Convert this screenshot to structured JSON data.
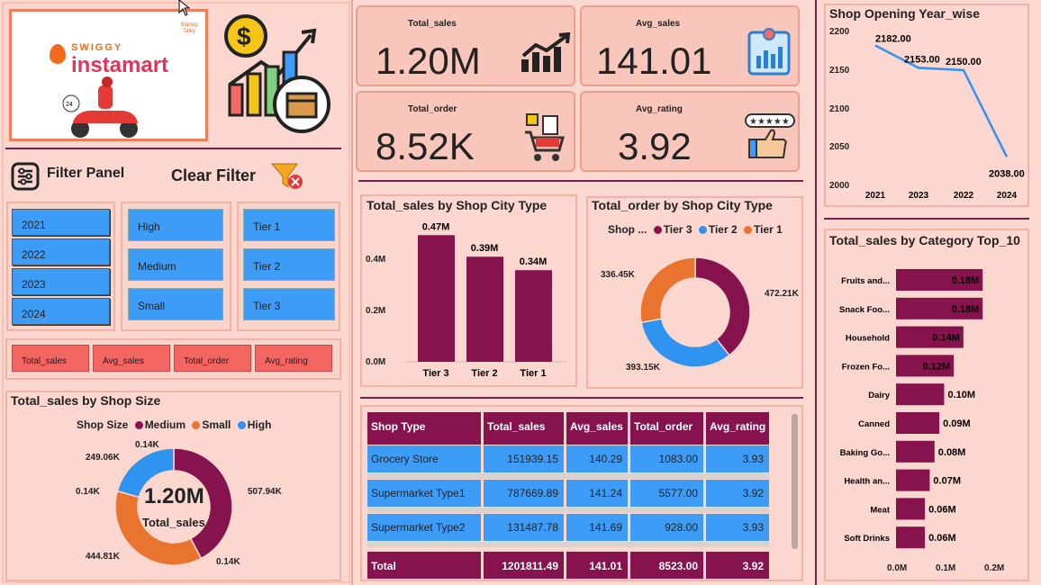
{
  "colors": {
    "maroon": "#86124e",
    "blue": "#2f93f0",
    "orange": "#e8742f",
    "slicer": "#3d9cf5",
    "button": "#f26561"
  },
  "logo": {
    "brand_top": "SWIGGY",
    "brand_bottom": "instamart",
    "badge": "Startup Talky"
  },
  "filter": {
    "title": "Filter Panel",
    "clear": "Clear Filter"
  },
  "slicers": {
    "years": [
      "2021",
      "2022",
      "2023",
      "2024"
    ],
    "sizes": [
      "High",
      "Medium",
      "Small"
    ],
    "tiers": [
      "Tier 1",
      "Tier 2",
      "Tier 3"
    ]
  },
  "metric_buttons": [
    "Total_sales",
    "Avg_sales",
    "Total_order",
    "Avg_rating"
  ],
  "kpis": [
    {
      "label": "Total_sales",
      "value": "1.20M",
      "icon": "growth-chart-icon"
    },
    {
      "label": "Avg_sales",
      "value": "141.01",
      "icon": "sales-report-icon"
    },
    {
      "label": "Total_order",
      "value": "8.52K",
      "icon": "shopping-cart-icon"
    },
    {
      "label": "Avg_rating",
      "value": "3.92",
      "icon": "thumbs-up-rating-icon"
    }
  ],
  "shop_size_chart": {
    "title": "Total_sales by Shop Size",
    "legend_title": "Shop Size",
    "center_value": "1.20M",
    "center_label": "Total_sales",
    "labels": [
      "507.94K",
      "444.81K",
      "249.06K",
      "0.14K",
      "0.14K",
      "0.14K"
    ]
  },
  "tier_sales_chart": {
    "title": "Total_sales by Shop City Type",
    "yticks": [
      "0.4M",
      "0.2M",
      "0.0M"
    ]
  },
  "tier_order_chart": {
    "title": "Total_order by Shop City Type",
    "legend_title": "Shop ...",
    "labels": [
      "472.21K",
      "393.15K",
      "336.45K"
    ]
  },
  "table": {
    "headers": [
      "Shop Type",
      "Total_sales",
      "Avg_sales",
      "Total_order",
      "Avg_rating"
    ],
    "rows": [
      [
        "Grocery Store",
        "151939.15",
        "140.29",
        "1083.00",
        "3.93"
      ],
      [
        "Supermarket Type1",
        "787669.89",
        "141.24",
        "5577.00",
        "3.92"
      ],
      [
        "Supermarket Type2",
        "131487.78",
        "141.69",
        "928.00",
        "3.93"
      ]
    ],
    "total": [
      "Total",
      "1201811.49",
      "141.01",
      "8523.00",
      "3.92"
    ]
  },
  "year_chart": {
    "title": "Shop Opening Year_wise",
    "yticks": [
      "2200",
      "2150",
      "2100",
      "2050",
      "2000"
    ]
  },
  "category_chart": {
    "title": "Total_sales by Category Top_10",
    "xticks": [
      "0.0M",
      "0.1M",
      "0.2M"
    ]
  },
  "chart_data": [
    {
      "type": "pie",
      "title": "Total_sales by Shop Size",
      "categories": [
        "Medium",
        "Small",
        "High"
      ],
      "values": [
        507.94,
        444.81,
        249.06
      ],
      "unit": "K"
    },
    {
      "type": "bar",
      "title": "Total_sales by Shop City Type",
      "categories": [
        "Tier 3",
        "Tier 2",
        "Tier 1"
      ],
      "values": [
        0.47,
        0.39,
        0.34
      ],
      "data_labels": [
        "0.47M",
        "0.39M",
        "0.34M"
      ],
      "ylim": [
        0,
        0.5
      ]
    },
    {
      "type": "pie",
      "title": "Total_order by Shop City Type",
      "categories": [
        "Tier 3",
        "Tier 2",
        "Tier 1"
      ],
      "values": [
        472.21,
        393.15,
        336.45
      ],
      "unit": "K"
    },
    {
      "type": "line",
      "title": "Shop Opening Year_wise",
      "categories": [
        "2021",
        "2023",
        "2022",
        "2024"
      ],
      "values": [
        2182,
        2153,
        2150,
        2038
      ],
      "data_labels": [
        "2182.00",
        "2153.00",
        "2150.00",
        "2038.00"
      ],
      "ylim": [
        2000,
        2200
      ]
    },
    {
      "type": "bar",
      "orientation": "horizontal",
      "title": "Total_sales by Category Top_10",
      "categories": [
        "Fruits and...",
        "Snack Foo...",
        "Household",
        "Frozen Fo...",
        "Dairy",
        "Canned",
        "Baking Go...",
        "Health an...",
        "Meat",
        "Soft Drinks"
      ],
      "values": [
        0.18,
        0.18,
        0.14,
        0.12,
        0.1,
        0.09,
        0.08,
        0.07,
        0.06,
        0.06
      ],
      "data_labels": [
        "0.18M",
        "0.18M",
        "0.14M",
        "0.12M",
        "0.10M",
        "0.09M",
        "0.08M",
        "0.07M",
        "0.06M",
        "0.06M"
      ],
      "xlim": [
        0,
        0.2
      ]
    }
  ]
}
